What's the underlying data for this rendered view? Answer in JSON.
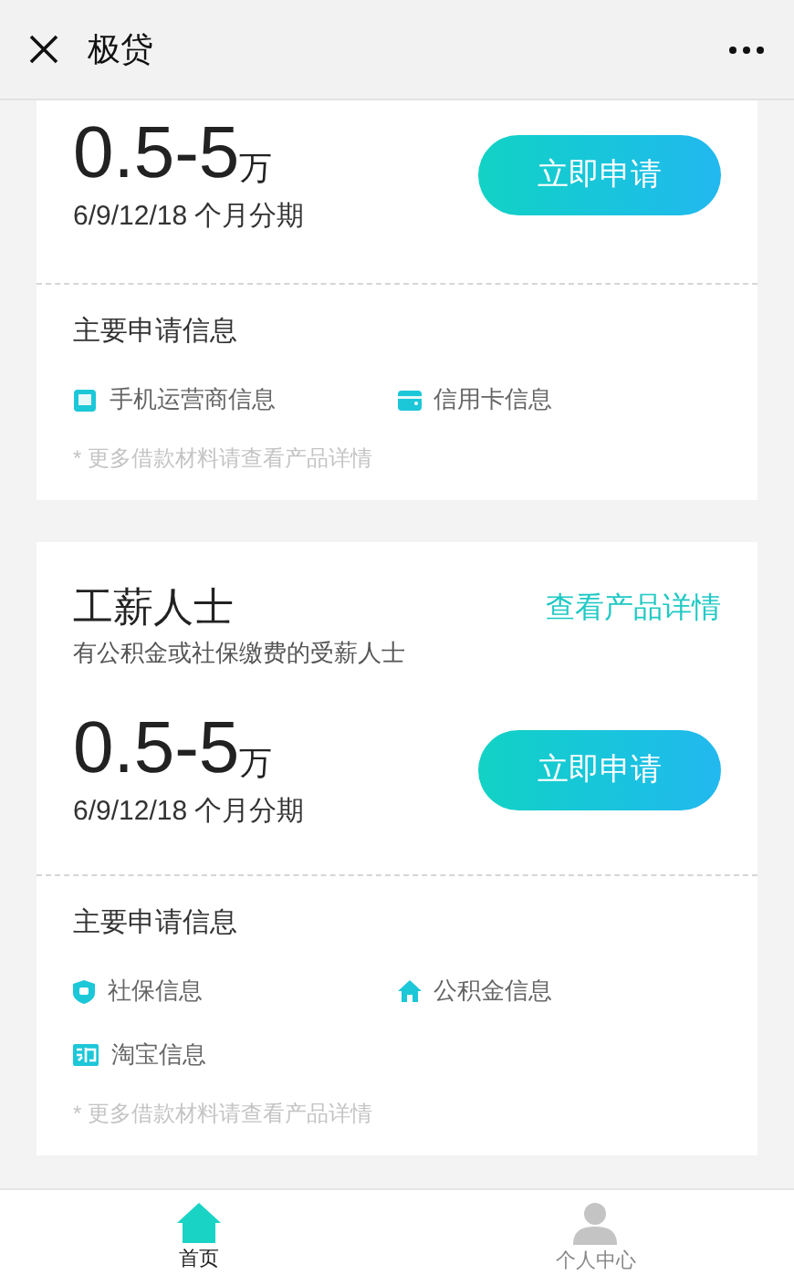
{
  "header": {
    "title": "极贷"
  },
  "products": [
    {
      "amount": "0.5-5",
      "unit": "万",
      "terms": "6/9/12/18 个月分期",
      "apply": "立即申请",
      "section_title": "主要申请信息",
      "items": [
        {
          "kind": "phone",
          "label": "手机运营商信息"
        },
        {
          "kind": "card",
          "label": "信用卡信息"
        }
      ],
      "note": "* 更多借款材料请查看产品详情"
    },
    {
      "title": "工薪人士",
      "subtitle": "有公积金或社保缴费的受薪人士",
      "link": "查看产品详情",
      "amount": "0.5-5",
      "unit": "万",
      "terms": "6/9/12/18 个月分期",
      "apply": "立即申请",
      "section_title": "主要申请信息",
      "items": [
        {
          "kind": "shield",
          "label": "社保信息"
        },
        {
          "kind": "home",
          "label": "公积金信息"
        },
        {
          "kind": "taobao",
          "label": "淘宝信息"
        }
      ],
      "note": "* 更多借款材料请查看产品详情"
    }
  ],
  "tabs": [
    {
      "kind": "home",
      "label": "首页",
      "selected": true
    },
    {
      "kind": "person",
      "label": "个人中心",
      "selected": false
    }
  ]
}
